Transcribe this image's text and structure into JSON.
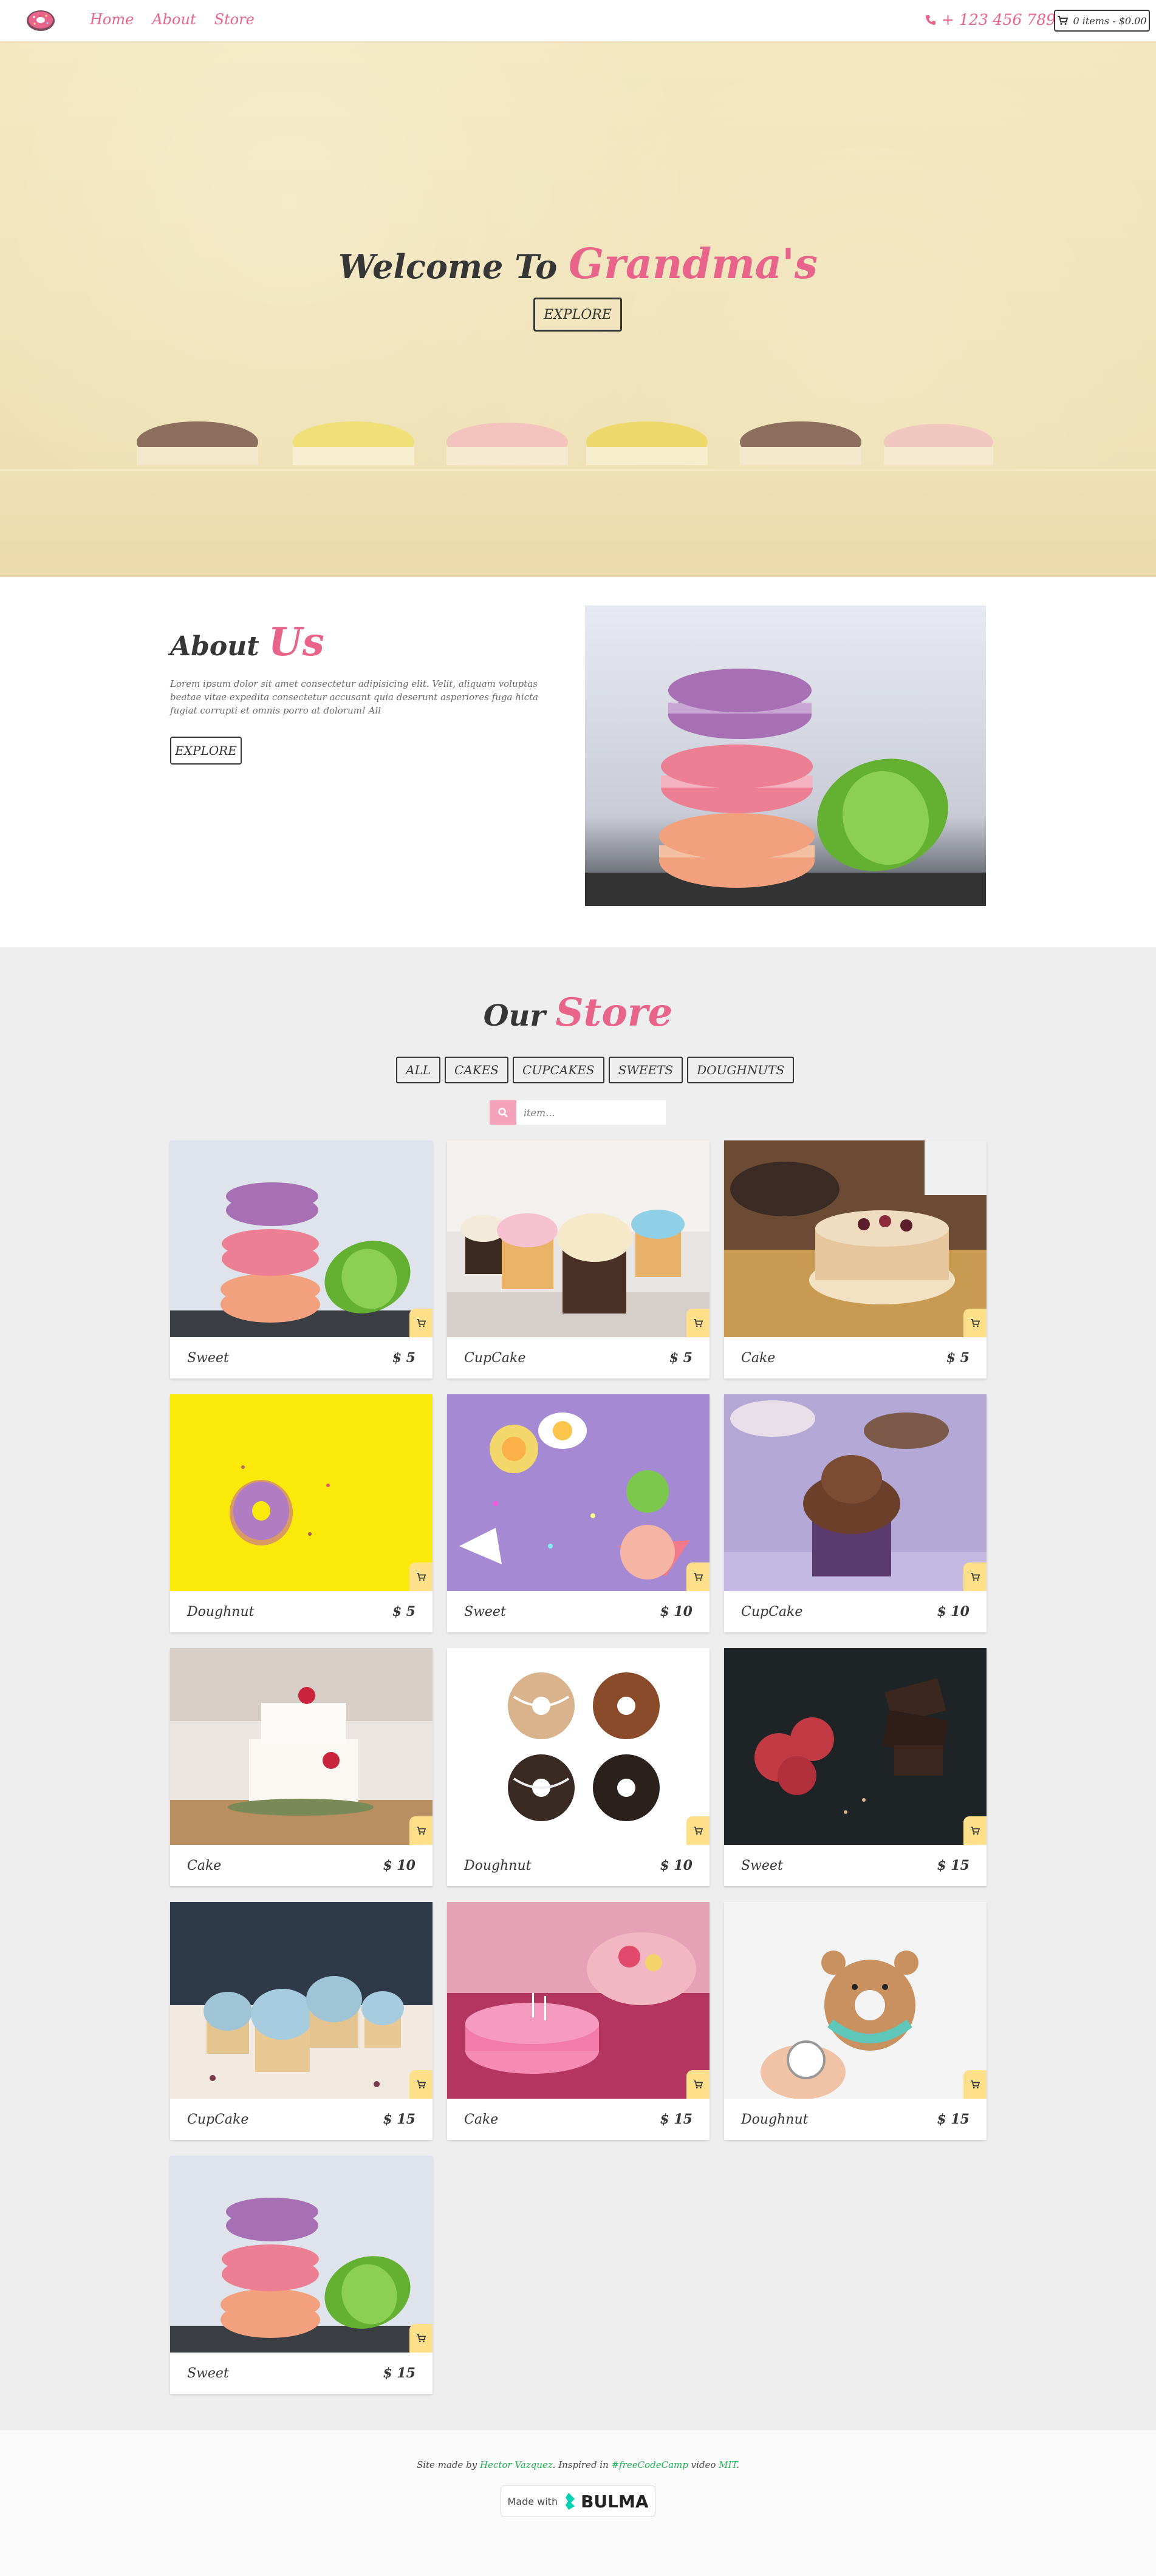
{
  "colors": {
    "accent": "#e8648a",
    "cart_badge": "#ffe08a",
    "store_bg": "#eeeeee",
    "hero_bg": "#f1e5bb"
  },
  "navbar": {
    "links": [
      "Home",
      "About",
      "Store"
    ],
    "phone": "+ 123 456 789",
    "cart": "0 items - $0.00"
  },
  "hero": {
    "title_prefix": "Welcome To",
    "title_accent": "Grandma's",
    "button": "EXPLORE"
  },
  "about": {
    "title_prefix": "About",
    "title_accent": "Us",
    "text": "Lorem ipsum dolor sit amet consectetur adipisicing elit. Velit, aliquam voluptas beatae vitae expedita consectetur accusant quia deserunt asperiores fuga hicta fugiat corrupti et omnis porro at dolorum! All",
    "button": "EXPLORE"
  },
  "store": {
    "title_prefix": "Our",
    "title_accent": "Store",
    "filters": [
      "ALL",
      "CAKES",
      "CUPCAKES",
      "SWEETS",
      "DOUGHNUTS"
    ],
    "search_placeholder": "item...",
    "items": [
      {
        "name": "Sweet",
        "price": "$ 5",
        "image": "macarons"
      },
      {
        "name": "CupCake",
        "price": "$ 5",
        "image": "cupcakes-row"
      },
      {
        "name": "Cake",
        "price": "$ 5",
        "image": "naked-cake"
      },
      {
        "name": "Doughnut",
        "price": "$ 5",
        "image": "donut-yellow"
      },
      {
        "name": "Sweet",
        "price": "$ 10",
        "image": "candies-purple"
      },
      {
        "name": "CupCake",
        "price": "$ 10",
        "image": "chocolate-cupcake"
      },
      {
        "name": "Cake",
        "price": "$ 10",
        "image": "wedding-cake"
      },
      {
        "name": "Doughnut",
        "price": "$ 10",
        "image": "donuts-four"
      },
      {
        "name": "Sweet",
        "price": "$ 15",
        "image": "chocolate-raspberry"
      },
      {
        "name": "CupCake",
        "price": "$ 15",
        "image": "blue-cupcakes"
      },
      {
        "name": "Cake",
        "price": "$ 15",
        "image": "pink-cake"
      },
      {
        "name": "Doughnut",
        "price": "$ 15",
        "image": "bear-donut"
      },
      {
        "name": "Sweet",
        "price": "$ 15",
        "image": "macarons"
      }
    ]
  },
  "footer": {
    "text_1": "Site made by ",
    "author": "Hector Vazquez",
    "text_2": ". Inspired in ",
    "inspired": "#freeCodeCamp",
    "text_3": " video ",
    "license": "MIT",
    "text_4": ".",
    "made_with": "Made with",
    "bulma": "BULMA"
  }
}
